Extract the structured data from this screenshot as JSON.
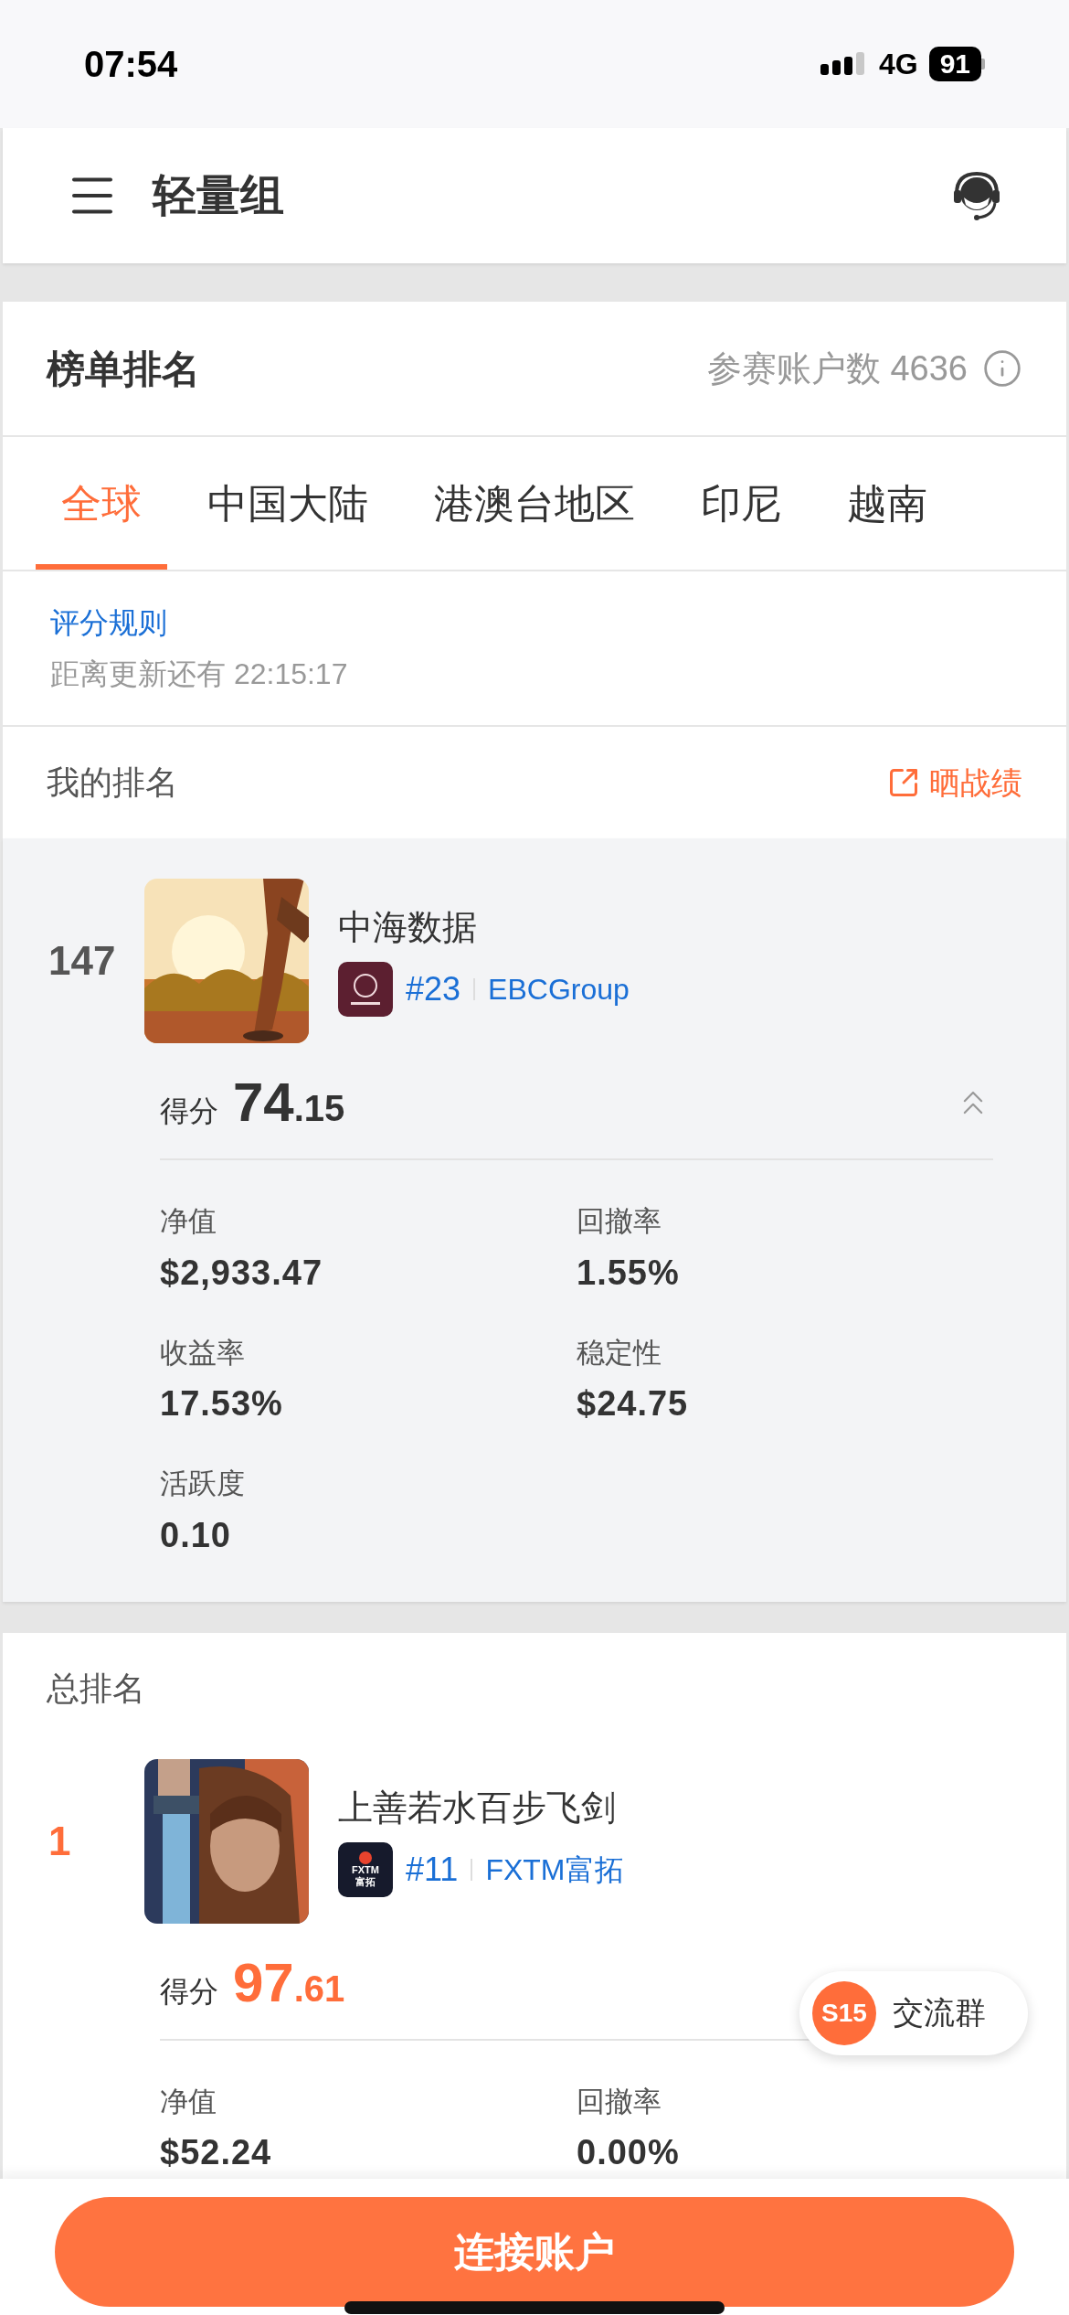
{
  "status_bar": {
    "time": "07:54",
    "network": "4G",
    "battery": "91"
  },
  "header": {
    "title": "轻量组"
  },
  "leaderboard": {
    "title": "榜单排名",
    "participants_label": "参赛账户数",
    "participants": "4636"
  },
  "tabs": [
    {
      "label": "全球",
      "selected": true
    },
    {
      "label": "中国大陆",
      "selected": false
    },
    {
      "label": "港澳台地区",
      "selected": false
    },
    {
      "label": "印尼",
      "selected": false
    },
    {
      "label": "越南",
      "selected": false
    }
  ],
  "rules": {
    "link": "评分规则",
    "countdown_label": "距离更新还有",
    "countdown": "22:15:17"
  },
  "my_ranking": {
    "title": "我的排名",
    "share": "晒战绩",
    "entry": {
      "rank": "147",
      "top": false,
      "name": "中海数据",
      "broker_logo": {
        "kind": "ebc"
      },
      "broker_rank": "#23",
      "broker": "EBCGroup",
      "score_label": "得分",
      "score_int": "74",
      "score_dec": ".15",
      "expanded": true,
      "stats": [
        {
          "label": "净值",
          "value": "$2,933.47"
        },
        {
          "label": "回撤率",
          "value": "1.55%"
        },
        {
          "label": "收益率",
          "value": "17.53%"
        },
        {
          "label": "稳定性",
          "value": "$24.75"
        },
        {
          "label": "活跃度",
          "value": "0.10"
        }
      ]
    }
  },
  "overall_ranking": {
    "title": "总排名",
    "entries": [
      {
        "rank": "1",
        "top": true,
        "name": "上善若水百步飞剑",
        "broker_logo": {
          "kind": "fxtm",
          "lines": [
            "FXTM",
            "富拓"
          ]
        },
        "broker_rank": "#11",
        "broker": "FXTM富拓",
        "score_label": "得分",
        "score_int": "97",
        "score_dec": ".61",
        "stats": [
          {
            "label": "净值",
            "value": "$52.24"
          },
          {
            "label": "回撤率",
            "value": "0.00%"
          }
        ]
      }
    ]
  },
  "float_button": {
    "badge": "S15",
    "label": "交流群"
  },
  "bottom_button": {
    "label": "连接账户"
  }
}
